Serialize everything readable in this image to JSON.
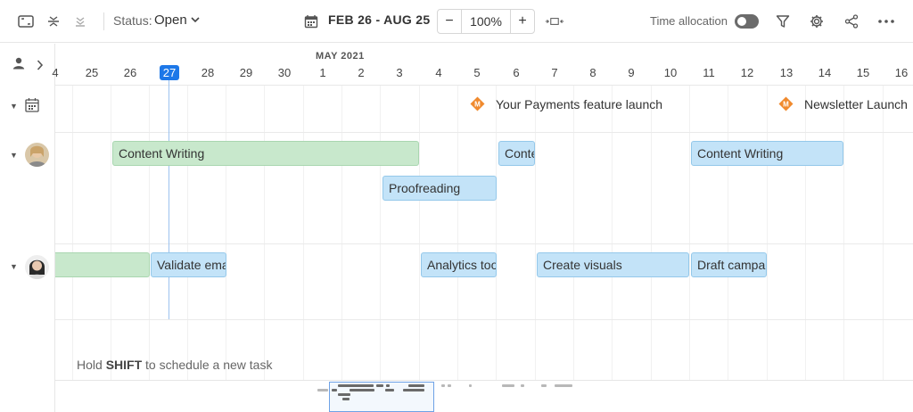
{
  "toolbar": {
    "icons": [
      "expand-icon",
      "collapse-rows-icon",
      "collapse-all-icon"
    ],
    "status_label": "Status:",
    "status_value": "Open",
    "date_range": "FEB 26 - AUG 25",
    "zoom_minus": "−",
    "zoom_value": "100%",
    "zoom_plus": "+",
    "time_allocation_label": "Time allocation",
    "time_allocation_on": false
  },
  "timeline": {
    "month": "MAY 2021",
    "days": [
      "4",
      "25",
      "26",
      "27",
      "28",
      "29",
      "30",
      "1",
      "2",
      "3",
      "4",
      "5",
      "6",
      "7",
      "8",
      "9",
      "10",
      "11",
      "12",
      "13",
      "14",
      "15",
      "16"
    ],
    "today": "27"
  },
  "milestones": [
    {
      "label": "Your Payments feature launch",
      "icon": "milestone-icon",
      "color": "#f08a2e"
    },
    {
      "label": "Newsletter Launch",
      "icon": "milestone-icon",
      "color": "#f08a2e"
    }
  ],
  "tasks": {
    "user1": [
      {
        "label": "Content Writing",
        "color": "green"
      },
      {
        "label": "Content Writing",
        "color": "blue"
      },
      {
        "label": "Content Writing",
        "color": "blue"
      },
      {
        "label": "Proofreading",
        "color": "blue"
      }
    ],
    "user2": [
      {
        "label": "",
        "color": "green"
      },
      {
        "label": "Validate email",
        "color": "blue"
      },
      {
        "label": "Analytics tools",
        "color": "blue"
      },
      {
        "label": "Create visuals",
        "color": "blue"
      },
      {
        "label": "Draft campaign",
        "color": "blue"
      }
    ]
  },
  "hint": {
    "prefix": "Hold ",
    "key": "SHIFT",
    "suffix": " to schedule a new task"
  },
  "colors": {
    "accent": "#1d78e8",
    "task_green": "#c8e8cc",
    "task_blue": "#c3e3f8",
    "milestone": "#f08a2e"
  }
}
